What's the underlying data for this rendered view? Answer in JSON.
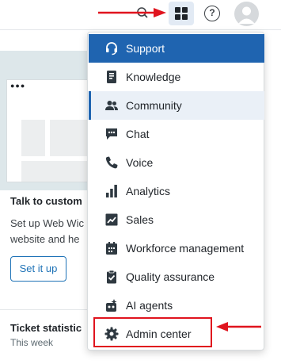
{
  "topbar": {
    "icons": [
      "search-icon",
      "apps-grid-icon",
      "help-icon",
      "user-avatar"
    ],
    "help_glyph": "?"
  },
  "background": {
    "card_title": "Talk to custom",
    "card_body_line1": "Set up Web Wic",
    "card_body_line2": "website and he",
    "setup_button": "Set it up",
    "stats_title": "Ticket statistic",
    "stats_subtitle": "This week"
  },
  "menu": {
    "items": [
      {
        "label": "Support",
        "icon": "headset-icon",
        "state": "active"
      },
      {
        "label": "Knowledge",
        "icon": "book-icon",
        "state": "normal"
      },
      {
        "label": "Community",
        "icon": "people-icon",
        "state": "hover"
      },
      {
        "label": "Chat",
        "icon": "chat-bubble-icon",
        "state": "normal"
      },
      {
        "label": "Voice",
        "icon": "phone-icon",
        "state": "normal"
      },
      {
        "label": "Analytics",
        "icon": "bar-chart-icon",
        "state": "normal"
      },
      {
        "label": "Sales",
        "icon": "trend-chart-icon",
        "state": "normal"
      },
      {
        "label": "Workforce management",
        "icon": "calendar-icon",
        "state": "normal"
      },
      {
        "label": "Quality assurance",
        "icon": "clipboard-check-icon",
        "state": "normal"
      },
      {
        "label": "AI agents",
        "icon": "robot-icon",
        "state": "normal"
      },
      {
        "label": "Admin center",
        "icon": "gear-icon",
        "state": "normal"
      }
    ]
  },
  "colors": {
    "accent": "#1f64b0",
    "annotation": "#e0141e",
    "hover": "#eaf0f7"
  }
}
